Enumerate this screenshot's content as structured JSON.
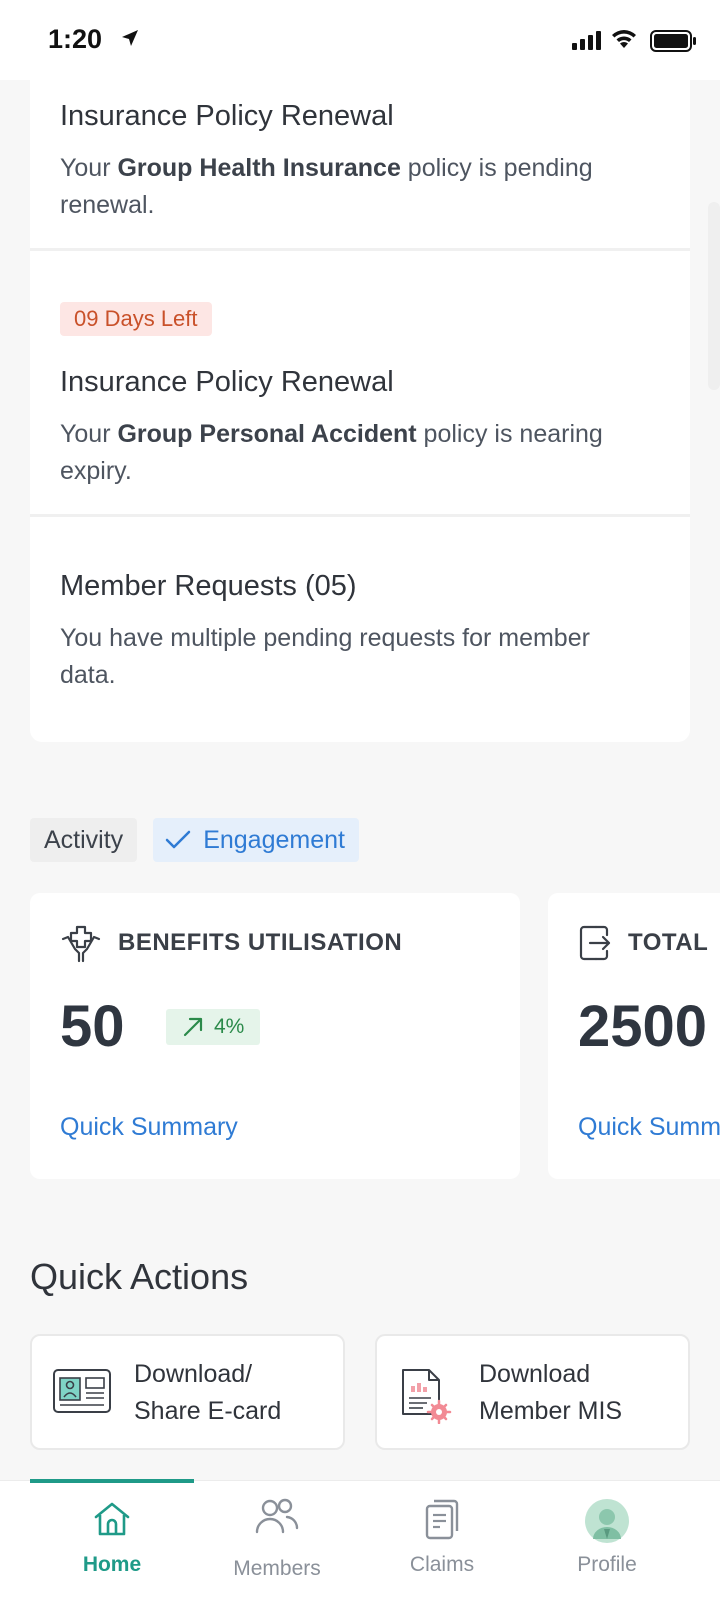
{
  "status_bar": {
    "time": "1:20"
  },
  "alerts": [
    {
      "title": "Insurance Policy Renewal",
      "desc_pre": "Your ",
      "desc_bold": "Group Health Insurance",
      "desc_line1_post": " policy is pending",
      "desc_line2": "renewal."
    },
    {
      "badge": "09 Days Left",
      "title": "Insurance Policy Renewal",
      "desc_pre": "Your ",
      "desc_bold": "Group Personal Accident",
      "desc_line1_post": " policy is nearing",
      "desc_line2": "expiry."
    },
    {
      "title": "Member Requests (05)",
      "desc_line1": "You have multiple pending requests for member",
      "desc_line2": "data."
    }
  ],
  "tabs": [
    {
      "label": "Activity",
      "selected": false
    },
    {
      "label": "Engagement",
      "selected": true
    }
  ],
  "metrics": [
    {
      "label": "BENEFITS UTILISATION",
      "icon": "hands-medical-cross-icon",
      "value": "50",
      "trend": "4%",
      "trend_direction": "up",
      "link": "Quick Summary"
    },
    {
      "label": "TOTAL",
      "icon": "exit-door-icon",
      "value": "2500",
      "link": "Quick Summ"
    }
  ],
  "quick_actions": {
    "title": "Quick Actions",
    "items": [
      {
        "line1": "Download/",
        "line2": "Share E-card",
        "icon": "id-card-icon"
      },
      {
        "line1": "Download",
        "line2": "Member MIS",
        "icon": "report-settings-icon"
      }
    ]
  },
  "bottom_nav": {
    "items": [
      {
        "label": "Home",
        "icon": "home-icon",
        "active": true
      },
      {
        "label": "Members",
        "icon": "members-icon",
        "active": false
      },
      {
        "label": "Claims",
        "icon": "claims-icon",
        "active": false
      },
      {
        "label": "Profile",
        "icon": "profile-avatar-icon",
        "active": false
      }
    ]
  },
  "colors": {
    "accent_teal": "#1f9a88",
    "link_blue": "#2f7bd4",
    "badge_red_bg": "#fde6e4",
    "badge_red_text": "#c9512a",
    "trend_green_bg": "#e5f4ea",
    "trend_green_text": "#2b8a4a"
  }
}
